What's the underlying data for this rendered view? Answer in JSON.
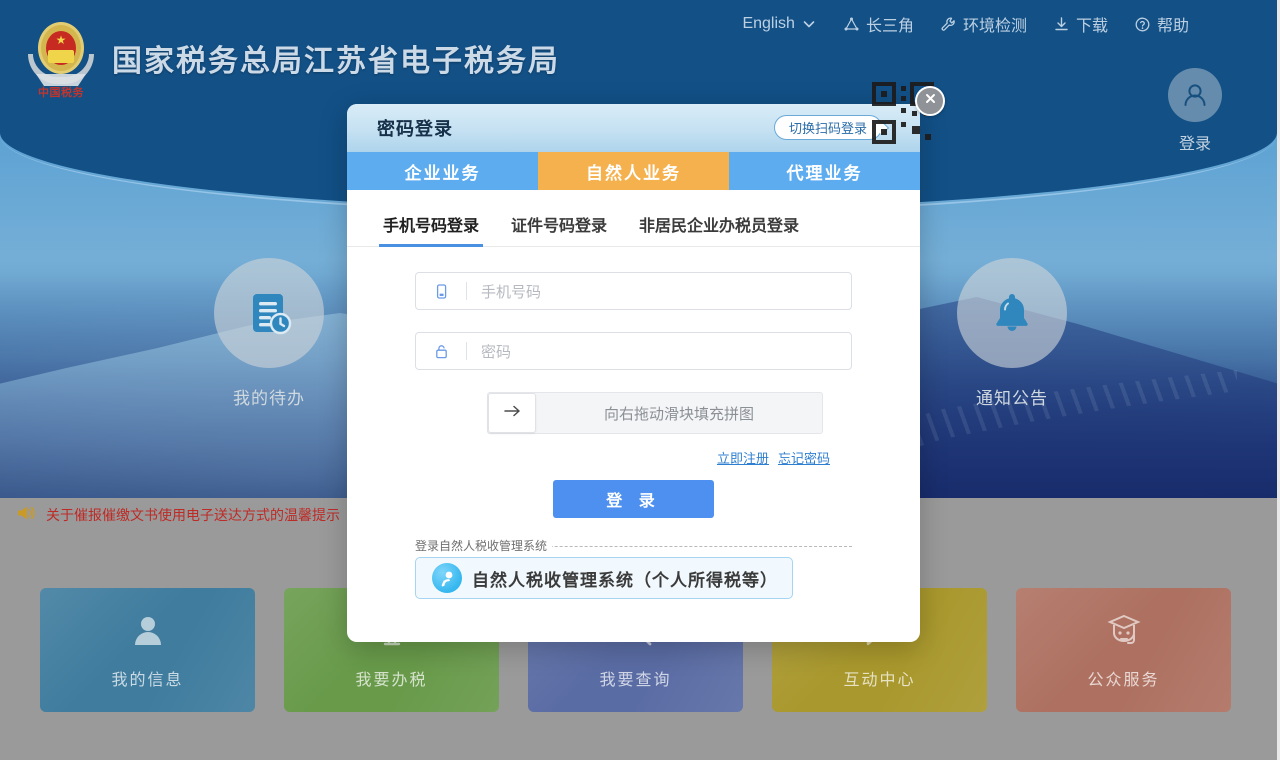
{
  "header": {
    "brand_title": "国家税务总局江苏省电子税务局",
    "emblem_label": "中国税务",
    "nav": [
      {
        "label": "English",
        "icon": "chevron-down-icon"
      },
      {
        "label": "长三角",
        "icon": "triangle-network-icon"
      },
      {
        "label": "环境检测",
        "icon": "wrench-icon"
      },
      {
        "label": "下载",
        "icon": "download-icon"
      },
      {
        "label": "帮助",
        "icon": "question-circle-icon"
      }
    ],
    "login_corner": {
      "label": "登录",
      "icon": "user-avatar-icon"
    }
  },
  "hero": {
    "features": [
      {
        "label": "我的待办",
        "icon": "document-clock-icon"
      },
      {
        "label": "通知公告",
        "icon": "bell-icon"
      }
    ]
  },
  "notice": {
    "icon": "megaphone-icon",
    "text": "关于催报催缴文书使用电子送达方式的温馨提示"
  },
  "cards": [
    {
      "label": "我的信息",
      "icon": "person-icon",
      "color": "#3f7c9e"
    },
    {
      "label": "我要办税",
      "icon": "monitor-icon",
      "color": "#689a4a"
    },
    {
      "label": "我要查询",
      "icon": "search-doc-icon",
      "color": "#5a6ca4"
    },
    {
      "label": "互动中心",
      "icon": "chat-bubble-icon",
      "color": "#a9982d"
    },
    {
      "label": "公众服务",
      "icon": "graduate-headset-icon",
      "color": "#ae7161"
    }
  ],
  "dialog": {
    "title": "密码登录",
    "switch_label": "切换扫码登录",
    "close_icon": "close-icon",
    "qr_icon": "qr-code-icon",
    "tabs": [
      {
        "label": "企业业务",
        "active": false
      },
      {
        "label": "自然人业务",
        "active": true
      },
      {
        "label": "代理业务",
        "active": false
      }
    ],
    "subtabs": [
      {
        "label": "手机号码登录",
        "active": true
      },
      {
        "label": "证件号码登录",
        "active": false
      },
      {
        "label": "非居民企业办税员登录",
        "active": false
      }
    ],
    "fields": [
      {
        "icon": "phone-icon",
        "placeholder": "手机号码",
        "value": ""
      },
      {
        "icon": "lock-icon",
        "placeholder": "密码",
        "value": ""
      }
    ],
    "captcha": {
      "handle_icon": "arrow-right-icon",
      "text": "向右拖动滑块填充拼图"
    },
    "links": [
      {
        "label": "立即注册"
      },
      {
        "label": "忘记密码"
      }
    ],
    "login_button": "登 录",
    "fieldset_legend": "登录自然人税收管理系统",
    "nat_system_button": {
      "label": "自然人税收管理系统（个人所得税等）",
      "icon": "tax-person-icon"
    }
  },
  "colors": {
    "header_blue": "#125086",
    "tab_blue": "#5cacef",
    "tab_orange": "#f5b14e",
    "primary_button": "#4d90f0",
    "link_blue": "#2f7fd0",
    "notice_red": "#bd2b26",
    "accent_underline": "#4a90e2"
  }
}
